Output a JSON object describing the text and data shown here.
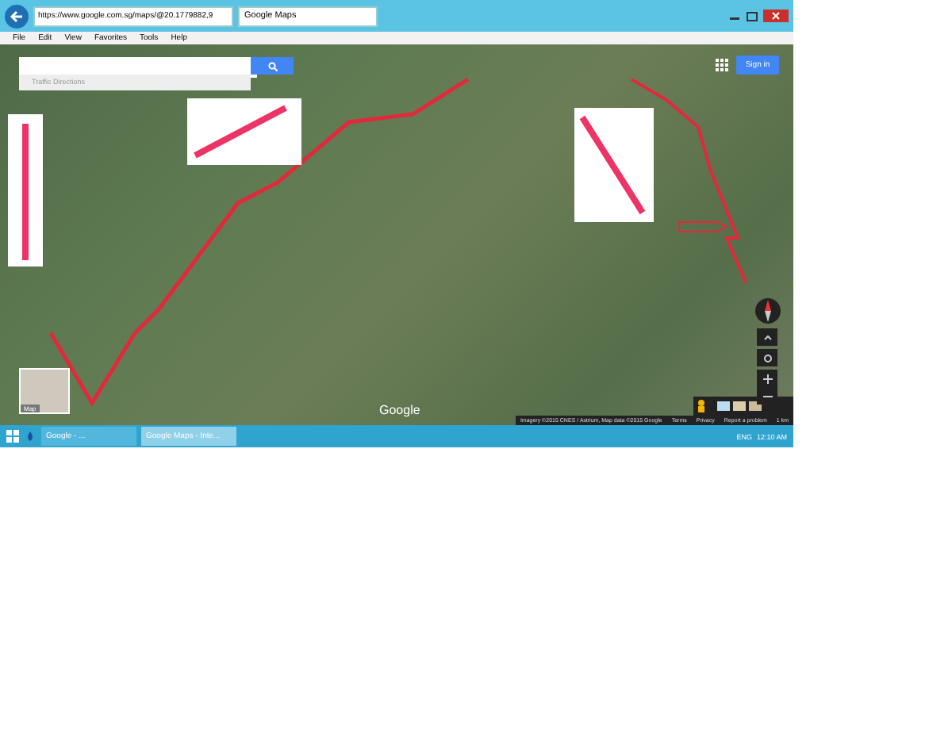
{
  "browser": {
    "address": "https://www.google.com.sg/maps/@20.1779882,9",
    "tab_title": "Google Maps",
    "menu": [
      "File",
      "Edit",
      "View",
      "Favorites",
      "Tools",
      "Help"
    ]
  },
  "map": {
    "search_suggestions": "Traffic Directions",
    "sign_in": "Sign in",
    "thumbnail_label": "Map",
    "logo": "Google",
    "footer": [
      "Imagery ©2015 CNES / Astrium, Map data ©2015 Google",
      "Terms",
      "Privacy",
      "Report a problem",
      "1 km"
    ]
  },
  "taskbar": {
    "windows": [
      {
        "title": "Google - ...",
        "selected": false
      },
      {
        "title": "Google Maps - Inte...",
        "selected": true
      }
    ],
    "language": "ENG",
    "clock": "12:10 AM"
  }
}
